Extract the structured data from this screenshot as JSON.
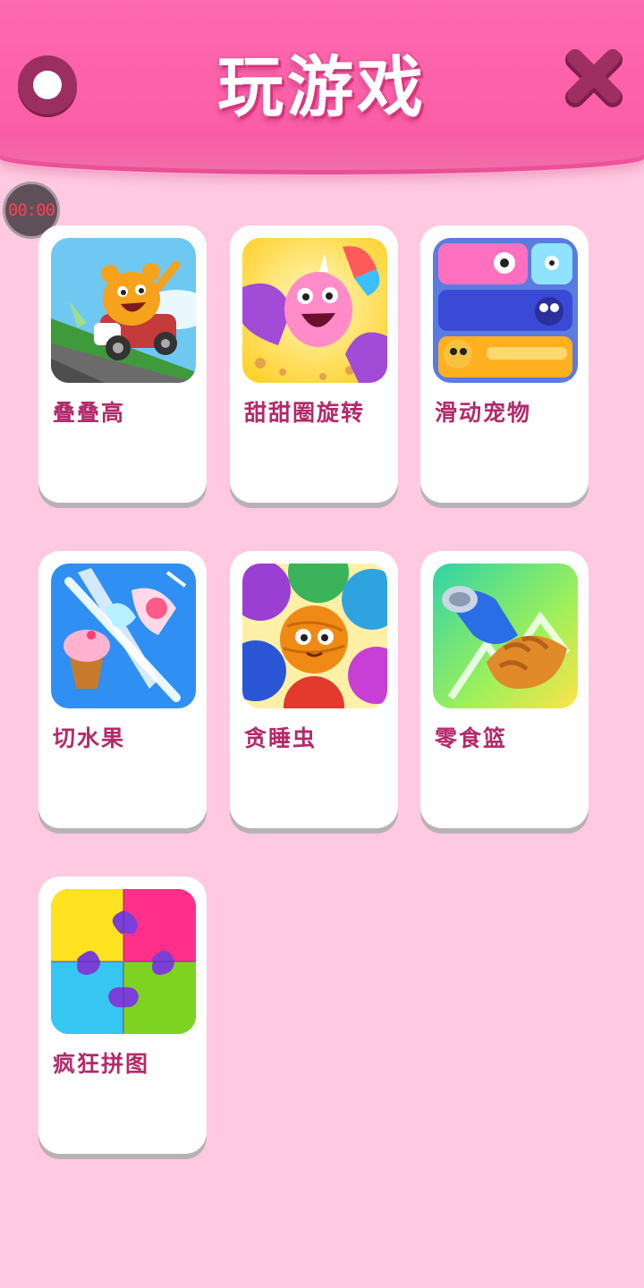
{
  "header": {
    "title": "玩游戏"
  },
  "timer": {
    "value": "00:00"
  },
  "games": [
    {
      "label": "叠叠高",
      "icon": "bear-kart-icon"
    },
    {
      "label": "甜甜圈旋转",
      "icon": "donut-monster-icon"
    },
    {
      "label": "滑动宠物",
      "icon": "sliding-pets-icon"
    },
    {
      "label": "切水果",
      "icon": "ice-cream-slice-icon"
    },
    {
      "label": "贪睡虫",
      "icon": "yarn-balls-icon"
    },
    {
      "label": "零食篮",
      "icon": "snack-croissant-icon"
    },
    {
      "label": "疯狂拼图",
      "icon": "jigsaw-puzzle-icon"
    }
  ],
  "colors": {
    "background": "#ffc9e1",
    "header": "#ff69b0",
    "label": "#b22a6b",
    "timer_text": "#ff3f52"
  }
}
